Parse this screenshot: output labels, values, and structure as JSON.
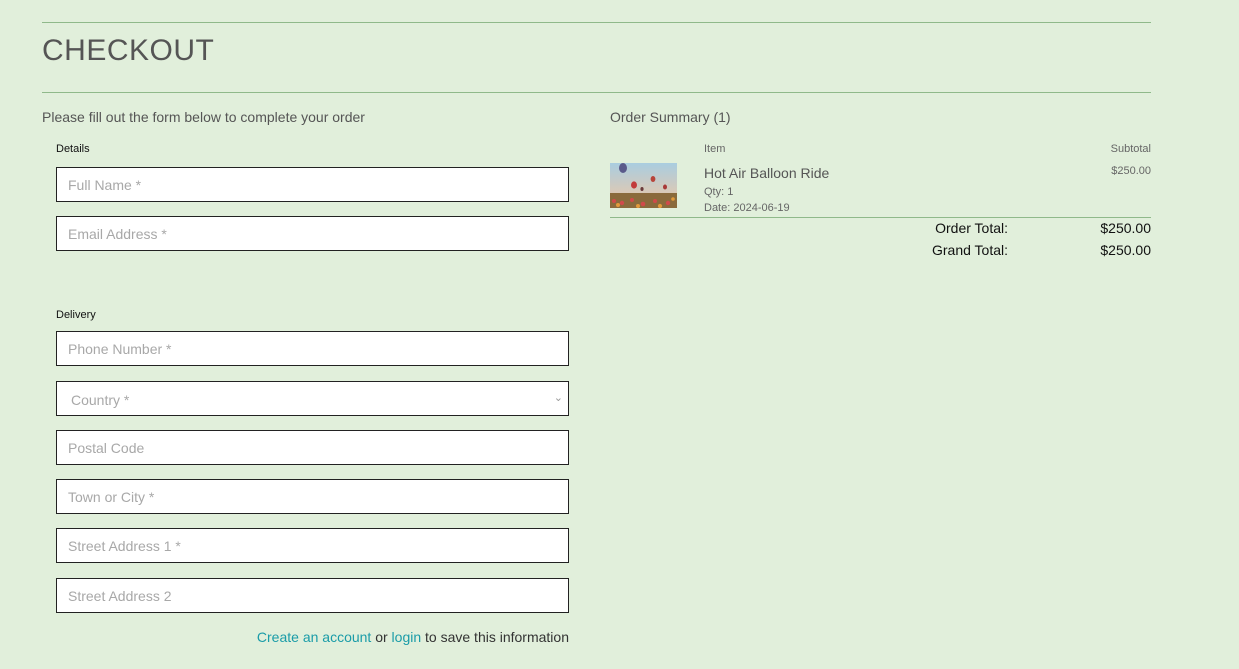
{
  "page": {
    "title": "CHECKOUT",
    "intro": "Please fill out the form below to complete your order"
  },
  "form": {
    "details_label": "Details",
    "delivery_label": "Delivery",
    "full_name": {
      "placeholder": "Full Name *",
      "value": ""
    },
    "email": {
      "placeholder": "Email Address *",
      "value": ""
    },
    "phone": {
      "placeholder": "Phone Number *",
      "value": ""
    },
    "country": {
      "selected": "Country *"
    },
    "postal_code": {
      "placeholder": "Postal Code",
      "value": ""
    },
    "town": {
      "placeholder": "Town or City *",
      "value": ""
    },
    "street1": {
      "placeholder": "Street Address 1 *",
      "value": ""
    },
    "street2": {
      "placeholder": "Street Address 2",
      "value": ""
    },
    "save": {
      "create_link": "Create an account",
      "or_text": " or ",
      "login_link": "login",
      "suffix": " to save this information"
    }
  },
  "summary": {
    "title": "Order Summary (1)",
    "col_item": "Item",
    "col_subtotal": "Subtotal",
    "items": [
      {
        "name": "Hot Air Balloon Ride",
        "qty": "Qty: 1",
        "date": "Date: 2024-06-19",
        "subtotal": "$250.00"
      }
    ],
    "order_total_label": "Order Total:",
    "order_total": "$250.00",
    "grand_total_label": "Grand Total:",
    "grand_total": "$250.00"
  },
  "colors": {
    "background": "#e1efdb",
    "rule": "#8fb98a",
    "link": "#1a9ca8"
  },
  "icons": {
    "select_arrow": "chevron-down-icon"
  }
}
